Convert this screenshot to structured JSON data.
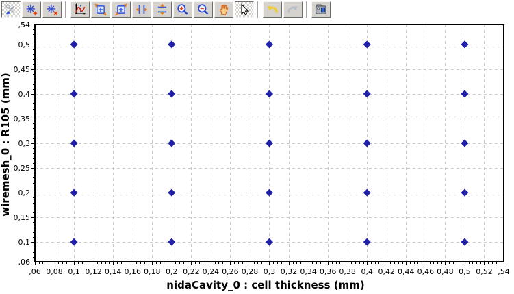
{
  "window": {
    "background": "#ffffff"
  },
  "toolbar": {
    "items": [
      {
        "type": "button",
        "name": "plot-settings",
        "icon": "tools-icon",
        "pressed": true
      },
      {
        "type": "button",
        "name": "add-datapoint",
        "icon": "crosshair-plus-icon",
        "pressed": false
      },
      {
        "type": "button",
        "name": "remove-datapoint",
        "icon": "crosshair-x-icon",
        "pressed": false
      },
      {
        "type": "separator"
      },
      {
        "type": "button",
        "name": "autoscale-axes",
        "icon": "axes-rescale-icon",
        "pressed": false
      },
      {
        "type": "button",
        "name": "zoom-box",
        "icon": "zoom-box-out-icon",
        "pressed": false
      },
      {
        "type": "button",
        "name": "zoom-window",
        "icon": "zoom-box-in-icon",
        "pressed": false
      },
      {
        "type": "button",
        "name": "stretch-horizontal",
        "icon": "expand-horizontal-icon",
        "pressed": false
      },
      {
        "type": "button",
        "name": "stretch-vertical",
        "icon": "expand-vertical-icon",
        "pressed": false
      },
      {
        "type": "button",
        "name": "zoom-in",
        "icon": "zoom-in-icon",
        "pressed": false
      },
      {
        "type": "button",
        "name": "zoom-out",
        "icon": "zoom-out-icon",
        "pressed": false
      },
      {
        "type": "button",
        "name": "pan",
        "icon": "hand-icon",
        "pressed": false
      },
      {
        "type": "button",
        "name": "select-pointer",
        "icon": "pointer-icon",
        "pressed": true
      },
      {
        "type": "separator"
      },
      {
        "type": "button",
        "name": "undo",
        "icon": "undo-icon",
        "pressed": false
      },
      {
        "type": "button",
        "name": "redo",
        "icon": "redo-icon",
        "pressed": false
      },
      {
        "type": "separator"
      },
      {
        "type": "button",
        "name": "snapshot",
        "icon": "camera-icon",
        "pressed": false
      }
    ]
  },
  "chart_data": {
    "type": "scatter",
    "title": "",
    "xlabel": "nidaCavity_0 : cell thickness (mm)",
    "ylabel": "wiremesh_0 : R105 (mm)",
    "xlim": [
      0.06,
      0.54
    ],
    "ylim": [
      0.06,
      0.54
    ],
    "x_ticks": {
      "values": [
        0.06,
        0.08,
        0.1,
        0.12,
        0.14,
        0.16,
        0.18,
        0.2,
        0.22,
        0.24,
        0.26,
        0.28,
        0.3,
        0.32,
        0.34,
        0.36,
        0.38,
        0.4,
        0.42,
        0.44,
        0.46,
        0.48,
        0.5,
        0.52,
        0.54
      ],
      "labels": [
        ",06",
        "0,08",
        "0,1",
        "0,12",
        "0,14",
        "0,16",
        "0,18",
        "0,2",
        "0,22",
        "0,24",
        "0,26",
        "0,28",
        "0,3",
        "0,32",
        "0,34",
        "0,36",
        "0,38",
        "0,4",
        "0,42",
        "0,44",
        "0,46",
        "0,48",
        "0,5",
        "0,52",
        ",54"
      ]
    },
    "y_ticks": {
      "values": [
        0.06,
        0.1,
        0.15,
        0.2,
        0.25,
        0.3,
        0.35,
        0.4,
        0.45,
        0.5,
        0.54
      ],
      "labels": [
        ",06",
        "0,1",
        "0,15",
        "0,2",
        "0,25",
        "0,3",
        "0,35",
        "0,4",
        "0,45",
        "0,5",
        ",54"
      ]
    },
    "x_minor_step": 0.004,
    "y_minor_step": 0.01,
    "grid": "dashed lines at every labeled tick",
    "grid_color": "#c9c9c9",
    "border_color": "#000000",
    "marker": {
      "shape": "diamond",
      "color": "#2020a8",
      "size": 11
    },
    "points": [
      [
        0.1,
        0.1
      ],
      [
        0.1,
        0.2
      ],
      [
        0.1,
        0.3
      ],
      [
        0.1,
        0.4
      ],
      [
        0.1,
        0.5
      ],
      [
        0.2,
        0.1
      ],
      [
        0.2,
        0.2
      ],
      [
        0.2,
        0.3
      ],
      [
        0.2,
        0.4
      ],
      [
        0.2,
        0.5
      ],
      [
        0.3,
        0.1
      ],
      [
        0.3,
        0.2
      ],
      [
        0.3,
        0.3
      ],
      [
        0.3,
        0.4
      ],
      [
        0.3,
        0.5
      ],
      [
        0.4,
        0.1
      ],
      [
        0.4,
        0.2
      ],
      [
        0.4,
        0.3
      ],
      [
        0.4,
        0.4
      ],
      [
        0.4,
        0.5
      ],
      [
        0.5,
        0.1
      ],
      [
        0.5,
        0.2
      ],
      [
        0.5,
        0.3
      ],
      [
        0.5,
        0.4
      ],
      [
        0.5,
        0.5
      ]
    ]
  }
}
